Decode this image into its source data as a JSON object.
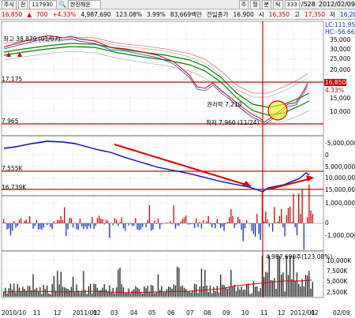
{
  "toolbar": {
    "market": "주식",
    "mode": "전",
    "code": "117930",
    "name": "한진해운",
    "period_buttons": [
      "주",
      "월",
      "분",
      "틱"
    ],
    "count": "333",
    "total": "528",
    "date": "2012/02/09"
  },
  "quote": {
    "price": "16,850",
    "change_arrow": "▲",
    "change": "700",
    "change_pct": "+4.33%",
    "volume": "4,987,690",
    "volume_pct": "123.08%",
    "turnover_pct": "3.99%",
    "trade_value": "83,669백만",
    "prev_close_label": "전일종가",
    "prev_close": "16,900",
    "open_label": "시",
    "open": "16,350",
    "high_label": "고",
    "high": "17,350",
    "low_label": "저",
    "low": "16,200"
  },
  "price_panel": {
    "high_note": "최고 38,879 (01/07)",
    "low_note": "최저 7,960 (11/24)",
    "ex_rights_note": "권리락 7,210",
    "line_17175": "17,175",
    "line_7965": "7,965",
    "lc": "LC:111.95",
    "hc": "HC:-56.66",
    "current_tag": "16,850",
    "current_pct": "4.33%",
    "axis": [
      "35,000",
      "30,000",
      "25,000",
      "20,000",
      "15,000",
      "10,000"
    ]
  },
  "obv_panel": {
    "label_top": "7,555K",
    "label_bottom": "16,739K",
    "axis": [
      "-5,000,000",
      "0",
      "5,000,000",
      "10,000,000",
      "15,000,000"
    ]
  },
  "diff_panel": {
    "axis": [
      "1,000,000",
      "0",
      "-1,000,000"
    ]
  },
  "volume_panel": {
    "annotation": "4,987,690주(123.08%)",
    "axis": [
      "10,000K",
      "7,500K",
      "5,000K",
      "2,500K"
    ]
  },
  "x_axis": [
    "2010/10",
    "11",
    "12",
    "2011/01",
    "02",
    "03",
    "04",
    "05",
    "06",
    "07",
    "08",
    "09",
    "10",
    "11",
    "12",
    "2012/01",
    "02"
  ],
  "x_axis_right": "02/09",
  "colors": {
    "up": "#d40000",
    "down": "#1030c0",
    "ma_green": "#008000",
    "grid": "#c8c8c8",
    "highlight": "#ffff00"
  }
}
